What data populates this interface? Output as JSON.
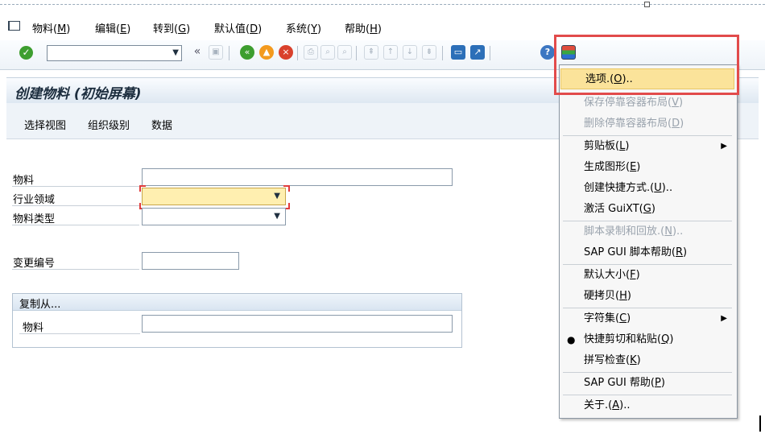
{
  "menubar": {
    "items": [
      {
        "label": "物料(",
        "key": "M",
        "end": ")"
      },
      {
        "label": "编辑(",
        "key": "E",
        "end": ")"
      },
      {
        "label": "转到(",
        "key": "G",
        "end": ")"
      },
      {
        "label": "默认值(",
        "key": "D",
        "end": ")"
      },
      {
        "label": "系统(",
        "key": "Y",
        "end": ")"
      },
      {
        "label": "帮助(",
        "key": "H",
        "end": ")"
      }
    ]
  },
  "toolbar": {
    "command_value": "",
    "back_glyph": "«"
  },
  "screen": {
    "title": "创建物料 (初始屏幕)",
    "app_buttons": [
      "选择视图",
      "组织级别",
      "数据"
    ]
  },
  "form": {
    "material_label": "物料",
    "material_value": "",
    "industry_label": "行业领域",
    "industry_value": "",
    "material_type_label": "物料类型",
    "material_type_value": "",
    "change_no_label": "变更编号",
    "change_no_value": "",
    "copy_from": {
      "title": "复制从...",
      "material_label": "物料",
      "material_value": ""
    }
  },
  "menu": {
    "items": [
      {
        "pre": "选项.(",
        "key": "O",
        "post": ")..",
        "state": "highlighted"
      },
      {
        "pre": "保存停靠容器布局(",
        "key": "V",
        "post": ")",
        "state": "disabled"
      },
      {
        "pre": "删除停靠容器布局(",
        "key": "D",
        "post": ")",
        "state": "disabled"
      },
      {
        "pre": "剪贴板(",
        "key": "L",
        "post": ")",
        "state": "normal",
        "submenu": "▶"
      },
      {
        "pre": "生成图形(",
        "key": "E",
        "post": ")",
        "state": "normal"
      },
      {
        "pre": "创建快捷方式.(",
        "key": "U",
        "post": ")..",
        "state": "normal"
      },
      {
        "pre": "激活 GuiXT(",
        "key": "G",
        "post": ")",
        "state": "normal"
      },
      {
        "pre": "脚本录制和回放.(",
        "key": "N",
        "post": ")..",
        "state": "disabled"
      },
      {
        "pre": "SAP GUI 脚本帮助(",
        "key": "R",
        "post": ")",
        "state": "normal"
      },
      {
        "pre": "默认大小(",
        "key": "F",
        "post": ")",
        "state": "normal"
      },
      {
        "pre": "硬拷贝(",
        "key": "H",
        "post": ")",
        "state": "normal"
      },
      {
        "pre": "字符集(",
        "key": "C",
        "post": ")",
        "state": "normal",
        "submenu": "▶"
      },
      {
        "pre": "快捷剪切和粘贴(",
        "key": "Q",
        "post": ")",
        "state": "checked",
        "bullet": "●"
      },
      {
        "pre": "拼写检查(",
        "key": "K",
        "post": ")",
        "state": "normal"
      },
      {
        "pre": "SAP GUI 帮助(",
        "key": "P",
        "post": ")",
        "state": "normal"
      },
      {
        "pre": "关于.(",
        "key": "A",
        "post": ")..",
        "state": "normal"
      }
    ]
  },
  "colors": {
    "highlight_border": "#e24b4b",
    "menu_highlight": "#fbe39a",
    "required_field": "#ffefb0"
  }
}
